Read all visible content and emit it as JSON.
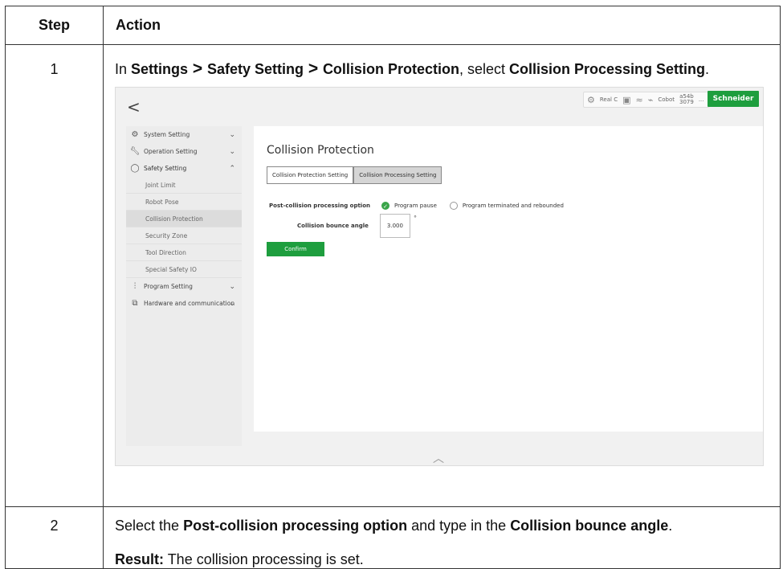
{
  "table": {
    "header_step": "Step",
    "header_action": "Action"
  },
  "row1": {
    "step": "1",
    "text_in": "In ",
    "settings": "Settings",
    "arrow1": " > ",
    "safety": "Safety Setting",
    "arrow2": " > ",
    "collision": "Collision Protection",
    "text_select": ", select ",
    "processing": "Collision Processing Setting",
    "period": "."
  },
  "screenshot": {
    "back_glyph": "<",
    "status": {
      "mode": "Real C",
      "cobot_label": "Cobot",
      "code_top": "a54b",
      "code_bottom": "3079",
      "more": "..."
    },
    "brand": "Schneider",
    "sidebar": {
      "system": "System Setting",
      "operation": "Operation Setting",
      "safety": "Safety Setting",
      "sub": [
        "Joint Limit",
        "Robot Pose",
        "Collision Protection",
        "Security Zone",
        "Tool Direction",
        "Special Safety IO"
      ],
      "program": "Program Setting",
      "hardware": "Hardware and communication"
    },
    "panel": {
      "title": "Collision Protection",
      "tab1": "Collision Protection Setting",
      "tab2": "Collision Processing Setting",
      "option_label": "Post-collision processing option",
      "option_a": "Program pause",
      "option_b": "Program terminated and rebounded",
      "angle_label": "Collision bounce angle",
      "angle_value": "3.000",
      "angle_unit": "°",
      "confirm": "Confirm"
    }
  },
  "row2": {
    "step": "2",
    "t1": "Select the ",
    "b1": "Post-collision processing option",
    "t2": " and type in the ",
    "b2": "Collision bounce angle",
    "t3": ".",
    "result_label": "Result:",
    "result_text": " The collision processing is set."
  }
}
